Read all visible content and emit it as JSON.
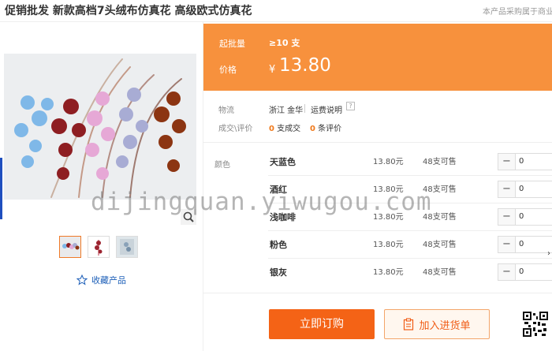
{
  "header": {
    "title": "促销批发 新款高档7头绒布仿真花 高级欧式仿真花",
    "notice": "本产品采购属于商业"
  },
  "gallery": {
    "thumbnails": [
      "thumb-1",
      "thumb-2",
      "thumb-3"
    ],
    "selected_thumbnail_index": 0,
    "favorite_label": "收藏产品"
  },
  "price_block": {
    "min_order_label": "起批量",
    "min_order_value": "≥10 支",
    "price_label": "价格",
    "currency_symbol": "¥",
    "price_value": "13.80"
  },
  "logistics": {
    "label": "物流",
    "origin": "浙江 金华",
    "shipping_link": "运费说明",
    "help_mark": "?"
  },
  "transactions": {
    "label": "成交\\评价",
    "deal_count": "0",
    "deal_suffix": "支成交",
    "review_count": "0",
    "review_suffix": "条评价"
  },
  "sku": {
    "color_label": "颜色",
    "rows": [
      {
        "name": "天蓝色",
        "price": "13.80元",
        "stock": "48支可售",
        "qty": "0"
      },
      {
        "name": "酒红",
        "price": "13.80元",
        "stock": "48支可售",
        "qty": "0"
      },
      {
        "name": "浅咖啡",
        "price": "13.80元",
        "stock": "48支可售",
        "qty": "0"
      },
      {
        "name": "粉色",
        "price": "13.80元",
        "stock": "48支可售",
        "qty": "0"
      },
      {
        "name": "银灰",
        "price": "13.80元",
        "stock": "48支可售",
        "qty": "0"
      }
    ]
  },
  "actions": {
    "buy_label": "立即订购",
    "cart_label": "加入进货单"
  },
  "watermark": "dijingquan.yiwugou.com",
  "colors": {
    "accent_orange": "#f7913d",
    "buy_button": "#f46316",
    "link_blue": "#1d5fb8"
  },
  "icons": [
    "zoom-icon",
    "star-icon",
    "clipboard-icon",
    "qr-code-icon",
    "minus-icon",
    "help-icon"
  ]
}
